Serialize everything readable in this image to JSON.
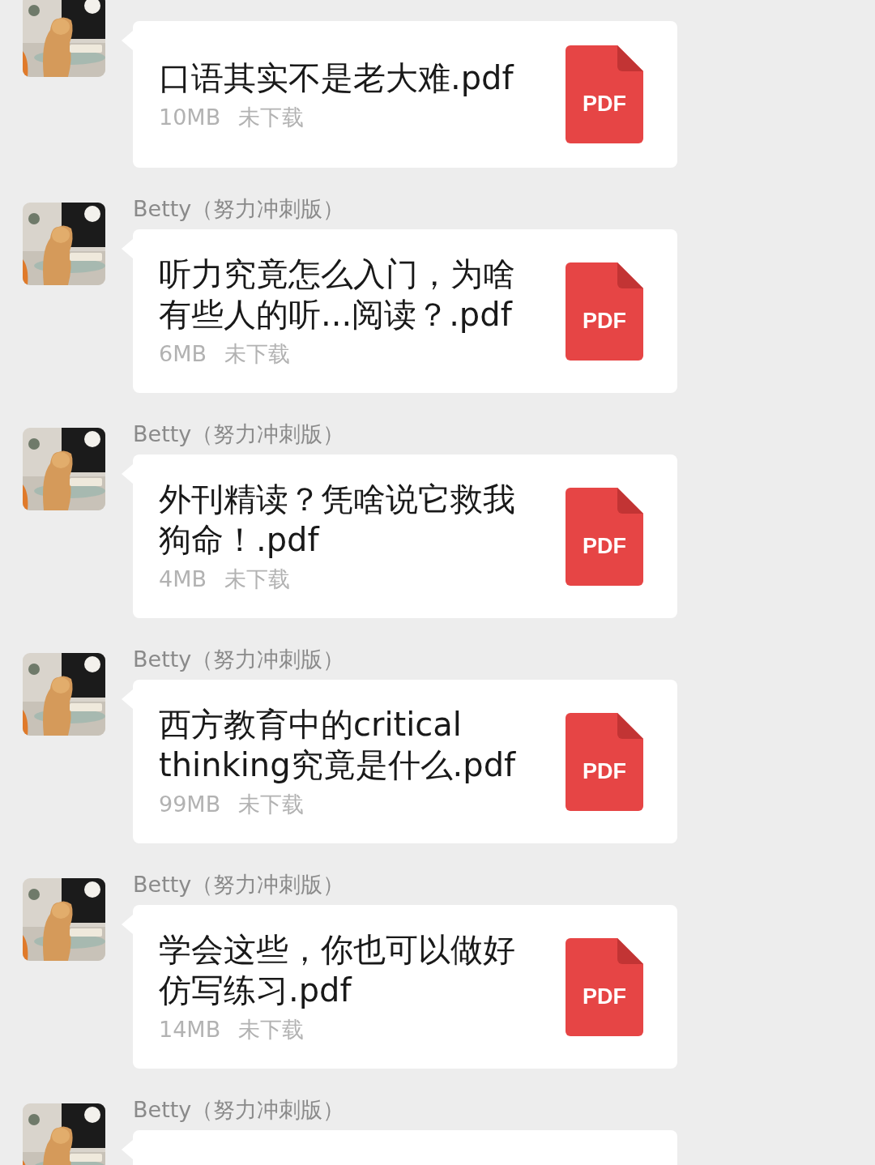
{
  "messages": [
    {
      "file": {
        "name": "口语其实不是老大难.pdf",
        "size": "10MB",
        "status": "未下载",
        "icon_label": "PDF"
      }
    },
    {
      "sender": "Betty（努力冲刺版）",
      "file": {
        "name": "听力究竟怎么入门，为啥有些人的听...阅读？.pdf",
        "size": "6MB",
        "status": "未下载",
        "icon_label": "PDF"
      }
    },
    {
      "sender": "Betty（努力冲刺版）",
      "file": {
        "name": "外刊精读？凭啥说它救我狗命！.pdf",
        "size": "4MB",
        "status": "未下载",
        "icon_label": "PDF"
      }
    },
    {
      "sender": "Betty（努力冲刺版）",
      "file": {
        "name": "西方教育中的critical thinking究竟是什么.pdf",
        "size": "99MB",
        "status": "未下载",
        "icon_label": "PDF"
      }
    },
    {
      "sender": "Betty（努力冲刺版）",
      "file": {
        "name": "学会这些，你也可以做好仿写练习.pdf",
        "size": "14MB",
        "status": "未下载",
        "icon_label": "PDF"
      }
    },
    {
      "sender": "Betty（努力冲刺版）"
    }
  ]
}
